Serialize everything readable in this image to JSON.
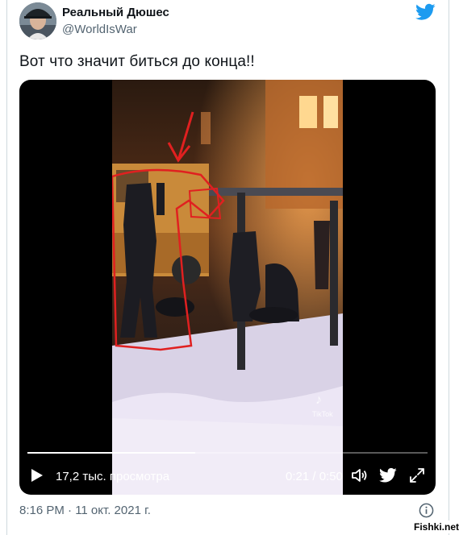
{
  "author": {
    "display_name": "Реальный Дюшес",
    "handle": "@WorldIsWar",
    "avatar_icon": "avatar-man-in-cap"
  },
  "brand": {
    "icon": "twitter-bird-icon",
    "color": "#1d9bf0"
  },
  "tweet": {
    "text": "Вот что значит биться до конца!!",
    "timestamp": "8:16 PM · 11 окт. 2021 г."
  },
  "video": {
    "views_label": "17,2 тыс. просмотра",
    "time_label": "0:21 / 0:50",
    "progress": 0.42,
    "overlay_watermark": "TikTok",
    "controls": [
      "play-icon",
      "volume-icon",
      "twitter-bird-icon",
      "expand-icon"
    ]
  },
  "footer": {
    "info_icon": "info-icon"
  },
  "site_watermark": "Fishki.net"
}
